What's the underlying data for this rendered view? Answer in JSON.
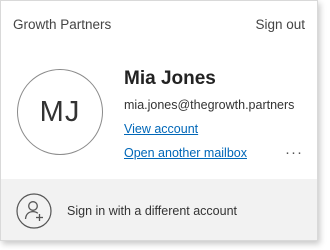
{
  "header": {
    "organization": "Growth Partners",
    "sign_out_label": "Sign out"
  },
  "account": {
    "initials": "MJ",
    "name": "Mia Jones",
    "email": "mia.jones@thegrowth.partners",
    "view_account_label": "View account",
    "open_mailbox_label": "Open another mailbox",
    "more_options_glyph": "···"
  },
  "footer": {
    "switch_account_label": "Sign in with a different account",
    "icon": "add-person-icon"
  },
  "colors": {
    "link": "#0067b8",
    "footer_bg": "#f2f2f2"
  }
}
